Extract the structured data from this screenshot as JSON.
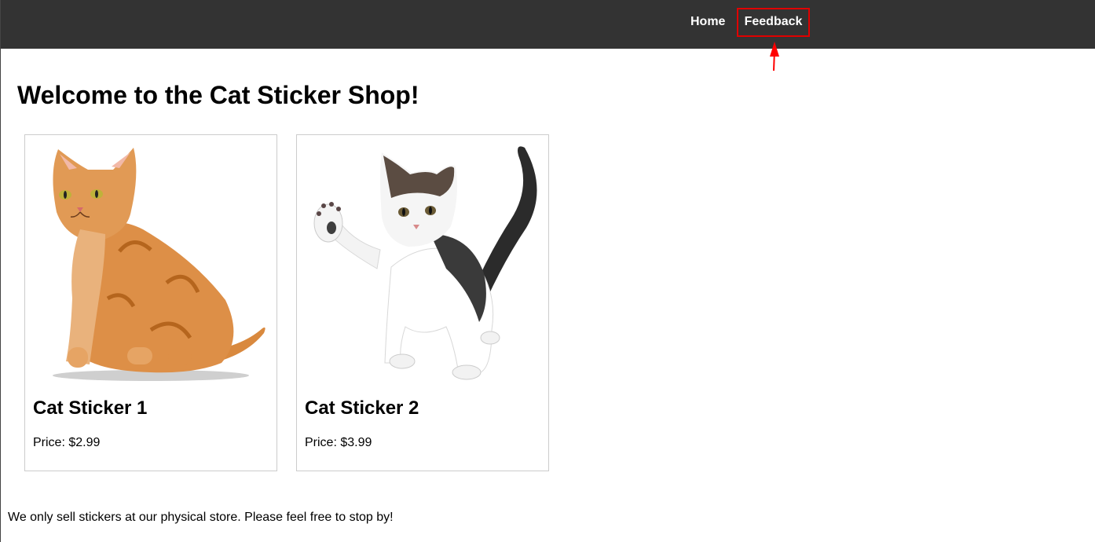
{
  "nav": {
    "home_label": "Home",
    "feedback_label": "Feedback"
  },
  "annotation": {
    "highlight_color": "#e00000",
    "highlighted_item": "Feedback"
  },
  "main": {
    "title": "Welcome to the Cat Sticker Shop!"
  },
  "products": [
    {
      "name": "Cat Sticker 1",
      "price": "Price: $2.99",
      "image": "orange-tabby-cat-sitting"
    },
    {
      "name": "Cat Sticker 2",
      "price": "Price: $3.99",
      "image": "white-tabby-kitten-raising-paw"
    }
  ],
  "footer": {
    "note": "We only sell stickers at our physical store. Please feel free to stop by!"
  },
  "colors": {
    "navbar_bg": "#333333",
    "nav_text": "#ffffff",
    "card_border": "#cccccc"
  }
}
